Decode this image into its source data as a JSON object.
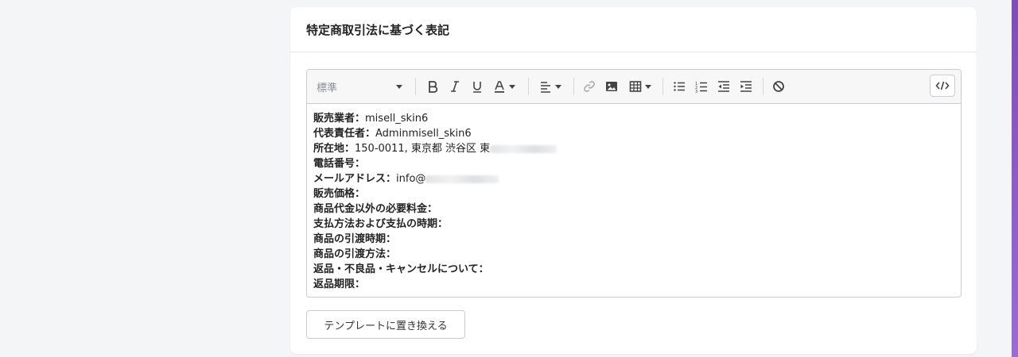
{
  "section": {
    "title": "特定商取引法に基づく表記"
  },
  "toolbar": {
    "style_select": "標準",
    "icons": [
      "caret-down-icon",
      "bold-icon",
      "italic-icon",
      "underline-icon",
      "font-color-icon",
      "align-icon",
      "link-icon",
      "image-icon",
      "table-icon",
      "unordered-list-icon",
      "ordered-list-icon",
      "outdent-icon",
      "indent-icon",
      "clear-format-icon",
      "code-view-icon"
    ]
  },
  "content": {
    "lines": [
      {
        "label": "販売業者：",
        "value": "misell_skin6"
      },
      {
        "label": "代表責任者：",
        "value": "Adminmisell_skin6"
      },
      {
        "label": "所在地：",
        "value": "150-0011, 東京都 渋谷区 東"
      },
      {
        "label": "電話番号：",
        "value": ""
      },
      {
        "label": "メールアドレス：",
        "value": "info@"
      },
      {
        "label": "販売価格：",
        "value": ""
      },
      {
        "label": "商品代金以外の必要料金：",
        "value": ""
      },
      {
        "label": "支払方法および支払の時期：",
        "value": ""
      },
      {
        "label": "商品の引渡時期：",
        "value": ""
      },
      {
        "label": "商品の引渡方法：",
        "value": ""
      },
      {
        "label": "返品・不良品・キャンセルについて：",
        "value": ""
      },
      {
        "label": "返品期限：",
        "value": ""
      }
    ]
  },
  "actions": {
    "replace_template": "テンプレートに置き換える"
  },
  "colors": {
    "accent": "#8a5cc9",
    "border": "#c9ccd1"
  }
}
